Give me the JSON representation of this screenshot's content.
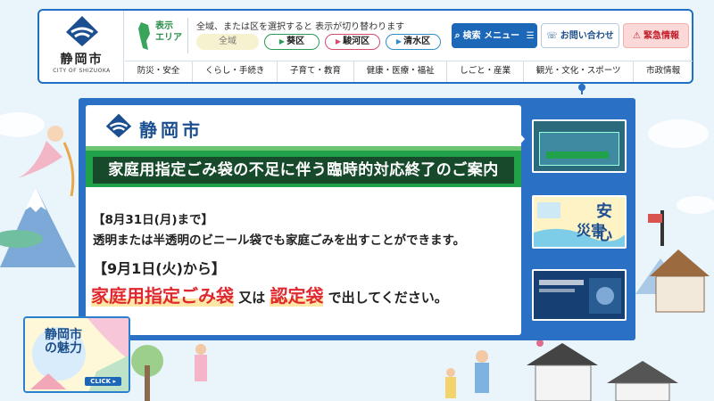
{
  "header": {
    "logo_name": "静岡市",
    "logo_sub": "CITY OF SHIZUOKA",
    "area_label_line1": "表示",
    "area_label_line2": "エリア",
    "area_description": "全域、または区を選択すると 表示が切り替わります",
    "wards": [
      {
        "label": "全域"
      },
      {
        "label": "葵区"
      },
      {
        "label": "駿河区"
      },
      {
        "label": "清水区"
      }
    ],
    "search_label": "検索 メニュー",
    "contact_label": "お問い合わせ",
    "emergency_label": "緊急情報"
  },
  "nav": {
    "items": [
      "防災・安全",
      "くらし・手続き",
      "子育て・教育",
      "健康・医療・福祉",
      "しごと・産業",
      "観光・文化・スポーツ",
      "市政情報"
    ]
  },
  "slide": {
    "logo_text": "静岡市",
    "banner": "家庭用指定ごみ袋の不足に伴う臨時的対応終了のご案内",
    "until_label": "【8月31日(月)まで】",
    "until_text": "透明または半透明のビニール袋でも家庭ごみを出すことができます。",
    "from_label": "【9月1日(火)から】",
    "from_red1": "家庭用指定ごみ袋",
    "from_mid": " 又は ",
    "from_red2": "認定袋",
    "from_end": " で出してください。"
  },
  "thumbs": {
    "thumb2_title": "安心",
    "thumb2_sub": "災害"
  },
  "charm": {
    "title": "静岡市の魅力",
    "click": "CLICK ▸"
  },
  "colors": {
    "brand_blue": "#1d67b8",
    "banner_green": "#1fa24a",
    "accent_red": "#e0282e",
    "emergency_bg": "#fbd9d9"
  }
}
